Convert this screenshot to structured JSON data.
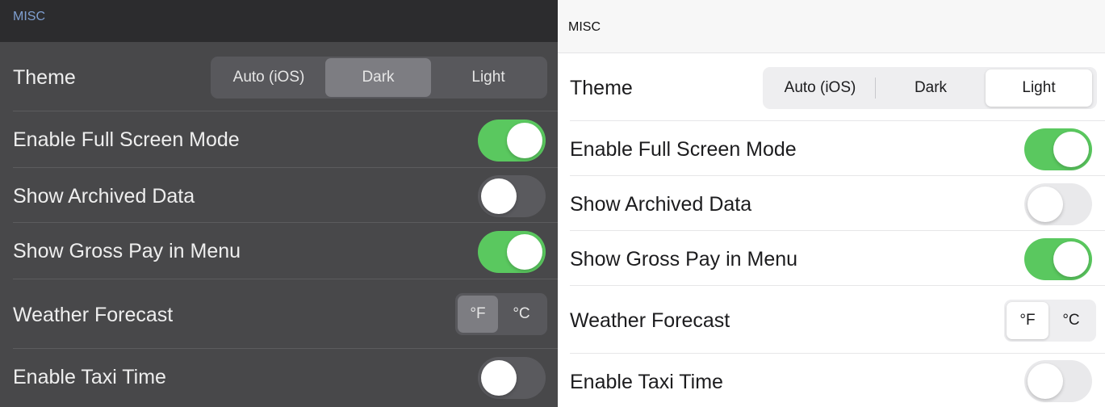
{
  "dark_panel": {
    "section_header": "MISC",
    "theme": {
      "label": "Theme",
      "options": [
        "Auto (iOS)",
        "Dark",
        "Light"
      ],
      "selected": "Dark"
    },
    "full_screen": {
      "label": "Enable Full Screen Mode",
      "on": true
    },
    "archived": {
      "label": "Show Archived Data",
      "on": false
    },
    "gross_pay": {
      "label": "Show Gross Pay in Menu",
      "on": true
    },
    "weather": {
      "label": "Weather Forecast",
      "options": [
        "°F",
        "°C"
      ],
      "selected": "°F"
    },
    "taxi": {
      "label": "Enable Taxi Time",
      "on": false
    }
  },
  "light_panel": {
    "section_header": "MISC",
    "theme": {
      "label": "Theme",
      "options": [
        "Auto (iOS)",
        "Dark",
        "Light"
      ],
      "selected": "Light"
    },
    "full_screen": {
      "label": "Enable Full Screen Mode",
      "on": true
    },
    "archived": {
      "label": "Show Archived Data",
      "on": false
    },
    "gross_pay": {
      "label": "Show Gross Pay in Menu",
      "on": true
    },
    "weather": {
      "label": "Weather Forecast",
      "options": [
        "°F",
        "°C"
      ],
      "selected": "°F"
    },
    "taxi": {
      "label": "Enable Taxi Time",
      "on": false
    }
  },
  "colors": {
    "toggle_on": "#5ac85f",
    "dark_bg": "#48484a",
    "dark_header": "#2c2c2e",
    "dark_header_text": "#7f9fd0",
    "light_bg": "#ffffff"
  }
}
